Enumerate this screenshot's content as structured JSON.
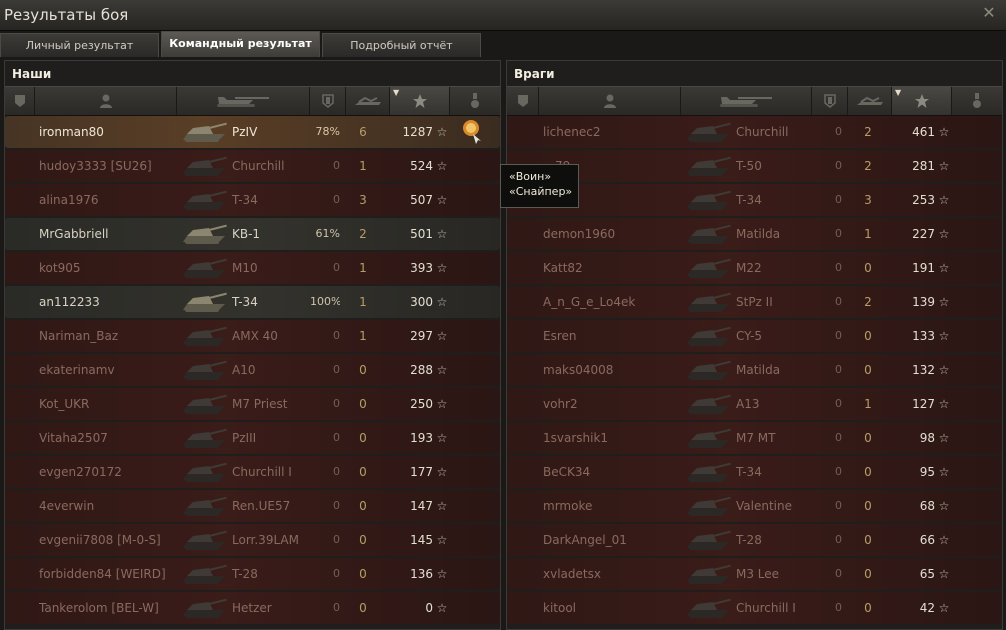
{
  "window": {
    "title": "Результаты боя"
  },
  "tabs": [
    "Личный результат",
    "Командный результат",
    "Подробный отчёт"
  ],
  "active_tab": 1,
  "teams": {
    "allies": {
      "name": "Наши",
      "rows": [
        {
          "name": "ironman80",
          "tank": "PzIV",
          "damage": "78%",
          "kills": "6",
          "xp": "1287",
          "state": "player",
          "medal": true
        },
        {
          "name": "hudoy3333 [SU26]",
          "tank": "Churchill",
          "damage": "0",
          "kills": "1",
          "xp": "524",
          "state": "dead",
          "medal": false
        },
        {
          "name": "alina1976",
          "tank": "T-34",
          "damage": "0",
          "kills": "3",
          "xp": "507",
          "state": "dead",
          "medal": false
        },
        {
          "name": "MrGabbriell",
          "tank": "KB-1",
          "damage": "61%",
          "kills": "2",
          "xp": "501",
          "state": "alive",
          "medal": false
        },
        {
          "name": "kot905",
          "tank": "M10",
          "damage": "0",
          "kills": "1",
          "xp": "393",
          "state": "dead",
          "medal": false
        },
        {
          "name": "an112233",
          "tank": "T-34",
          "damage": "100%",
          "kills": "1",
          "xp": "300",
          "state": "alive",
          "medal": false
        },
        {
          "name": "Nariman_Baz",
          "tank": "AMX 40",
          "damage": "0",
          "kills": "1",
          "xp": "297",
          "state": "dead",
          "medal": false
        },
        {
          "name": "ekaterinamv",
          "tank": "A10",
          "damage": "0",
          "kills": "0",
          "xp": "288",
          "state": "dead",
          "medal": false
        },
        {
          "name": "Kot_UKR",
          "tank": "M7 Priest",
          "damage": "0",
          "kills": "0",
          "xp": "250",
          "state": "dead",
          "medal": false
        },
        {
          "name": "Vitaha2507",
          "tank": "PzIII",
          "damage": "0",
          "kills": "0",
          "xp": "193",
          "state": "dead",
          "medal": false
        },
        {
          "name": "evgen270172",
          "tank": "Churchill I",
          "damage": "0",
          "kills": "0",
          "xp": "177",
          "state": "dead",
          "medal": false
        },
        {
          "name": "4everwin",
          "tank": "Ren.UE57",
          "damage": "0",
          "kills": "0",
          "xp": "147",
          "state": "dead",
          "medal": false
        },
        {
          "name": "evgenii7808 [M-0-S]",
          "tank": "Lorr.39LAM",
          "damage": "0",
          "kills": "0",
          "xp": "145",
          "state": "dead",
          "medal": false
        },
        {
          "name": "forbidden84 [WEIRD]",
          "tank": "T-28",
          "damage": "0",
          "kills": "0",
          "xp": "136",
          "state": "dead",
          "medal": false
        },
        {
          "name": "Tankerolom [BEL-W]",
          "tank": "Hetzer",
          "damage": "0",
          "kills": "0",
          "xp": "0",
          "state": "dead",
          "medal": false
        }
      ]
    },
    "enemies": {
      "name": "Враги",
      "rows": [
        {
          "name": "lichenec2",
          "tank": "Churchill",
          "damage": "0",
          "kills": "2",
          "xp": "461",
          "state": "dead"
        },
        {
          "name": "…79",
          "tank": "T-50",
          "damage": "0",
          "kills": "2",
          "xp": "281",
          "state": "dead"
        },
        {
          "name": "…_05",
          "tank": "T-34",
          "damage": "0",
          "kills": "3",
          "xp": "253",
          "state": "dead"
        },
        {
          "name": "demon1960",
          "tank": "Matilda",
          "damage": "0",
          "kills": "1",
          "xp": "227",
          "state": "dead"
        },
        {
          "name": "Katt82",
          "tank": "M22",
          "damage": "0",
          "kills": "0",
          "xp": "191",
          "state": "dead"
        },
        {
          "name": "A_n_G_e_Lo4ek",
          "tank": "StPz II",
          "damage": "0",
          "kills": "2",
          "xp": "139",
          "state": "dead"
        },
        {
          "name": "Esren",
          "tank": "CY-5",
          "damage": "0",
          "kills": "0",
          "xp": "133",
          "state": "dead"
        },
        {
          "name": "maks04008",
          "tank": "Matilda",
          "damage": "0",
          "kills": "0",
          "xp": "132",
          "state": "dead"
        },
        {
          "name": "vohr2",
          "tank": "A13",
          "damage": "0",
          "kills": "1",
          "xp": "127",
          "state": "dead"
        },
        {
          "name": "1svarshik1",
          "tank": "M7 MT",
          "damage": "0",
          "kills": "0",
          "xp": "98",
          "state": "dead"
        },
        {
          "name": "BeCK34",
          "tank": "T-34",
          "damage": "0",
          "kills": "0",
          "xp": "95",
          "state": "dead"
        },
        {
          "name": "mrmoke",
          "tank": "Valentine",
          "damage": "0",
          "kills": "0",
          "xp": "68",
          "state": "dead"
        },
        {
          "name": "DarkAngel_01",
          "tank": "T-28",
          "damage": "0",
          "kills": "0",
          "xp": "66",
          "state": "dead"
        },
        {
          "name": "xvladetsx",
          "tank": "M3 Lee",
          "damage": "0",
          "kills": "0",
          "xp": "65",
          "state": "dead"
        },
        {
          "name": "kitool",
          "tank": "Churchill I",
          "damage": "0",
          "kills": "0",
          "xp": "42",
          "state": "dead"
        }
      ]
    }
  },
  "tooltip": {
    "lines": [
      "«Воин»",
      "«Снайпер»"
    ]
  },
  "icons": {
    "header": [
      "squad-icon",
      "player-icon",
      "tank-icon",
      "damage-shield-icon",
      "kills-icon",
      "xp-star-icon",
      "medal-icon"
    ],
    "close": "close-icon",
    "star": "☆"
  },
  "colors": {
    "player_row": "#5a3e26",
    "alive_row": "#33322d",
    "dead_row": "#3a1c19",
    "xp_text": "#e4dfd2"
  }
}
